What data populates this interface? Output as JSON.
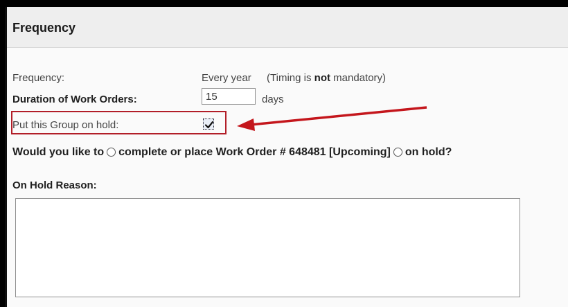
{
  "section": {
    "title": "Frequency"
  },
  "frequency": {
    "label": "Frequency:",
    "value": "Every year",
    "timing_prefix": "(Timing is ",
    "timing_bold": "not",
    "timing_suffix": " mandatory)"
  },
  "duration": {
    "label": "Duration of Work Orders:",
    "value": "15",
    "unit": "days"
  },
  "hold": {
    "label": "Put this Group on hold:",
    "checked": true
  },
  "work_order": {
    "prefix": "Would you like to",
    "option1": "complete or place Work Order # 648481 [Upcoming]",
    "option2": "on hold?"
  },
  "reason": {
    "label": "On Hold Reason:",
    "value": ""
  },
  "colors": {
    "highlight": "#b21e28",
    "arrow": "#c4161c"
  },
  "icons": {
    "checkmark": "checkmark-icon",
    "arrow": "arrow-left-icon"
  }
}
